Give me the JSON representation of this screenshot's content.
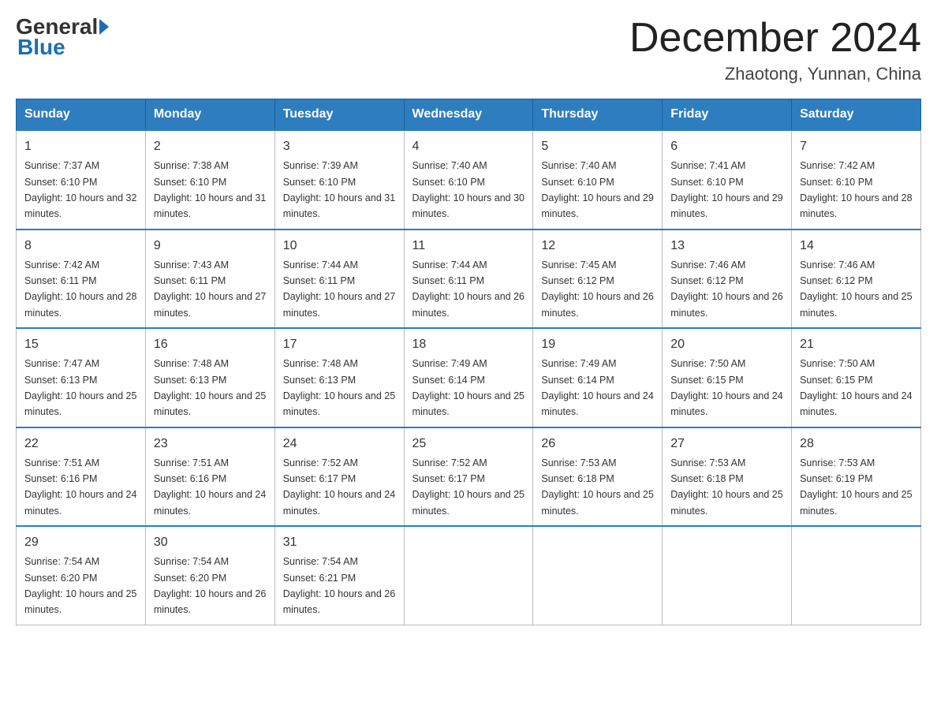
{
  "logo": {
    "general": "General",
    "blue": "Blue"
  },
  "header": {
    "month": "December 2024",
    "location": "Zhaotong, Yunnan, China"
  },
  "days_of_week": [
    "Sunday",
    "Monday",
    "Tuesday",
    "Wednesday",
    "Thursday",
    "Friday",
    "Saturday"
  ],
  "weeks": [
    [
      {
        "day": "1",
        "sunrise": "7:37 AM",
        "sunset": "6:10 PM",
        "daylight": "10 hours and 32 minutes."
      },
      {
        "day": "2",
        "sunrise": "7:38 AM",
        "sunset": "6:10 PM",
        "daylight": "10 hours and 31 minutes."
      },
      {
        "day": "3",
        "sunrise": "7:39 AM",
        "sunset": "6:10 PM",
        "daylight": "10 hours and 31 minutes."
      },
      {
        "day": "4",
        "sunrise": "7:40 AM",
        "sunset": "6:10 PM",
        "daylight": "10 hours and 30 minutes."
      },
      {
        "day": "5",
        "sunrise": "7:40 AM",
        "sunset": "6:10 PM",
        "daylight": "10 hours and 29 minutes."
      },
      {
        "day": "6",
        "sunrise": "7:41 AM",
        "sunset": "6:10 PM",
        "daylight": "10 hours and 29 minutes."
      },
      {
        "day": "7",
        "sunrise": "7:42 AM",
        "sunset": "6:10 PM",
        "daylight": "10 hours and 28 minutes."
      }
    ],
    [
      {
        "day": "8",
        "sunrise": "7:42 AM",
        "sunset": "6:11 PM",
        "daylight": "10 hours and 28 minutes."
      },
      {
        "day": "9",
        "sunrise": "7:43 AM",
        "sunset": "6:11 PM",
        "daylight": "10 hours and 27 minutes."
      },
      {
        "day": "10",
        "sunrise": "7:44 AM",
        "sunset": "6:11 PM",
        "daylight": "10 hours and 27 minutes."
      },
      {
        "day": "11",
        "sunrise": "7:44 AM",
        "sunset": "6:11 PM",
        "daylight": "10 hours and 26 minutes."
      },
      {
        "day": "12",
        "sunrise": "7:45 AM",
        "sunset": "6:12 PM",
        "daylight": "10 hours and 26 minutes."
      },
      {
        "day": "13",
        "sunrise": "7:46 AM",
        "sunset": "6:12 PM",
        "daylight": "10 hours and 26 minutes."
      },
      {
        "day": "14",
        "sunrise": "7:46 AM",
        "sunset": "6:12 PM",
        "daylight": "10 hours and 25 minutes."
      }
    ],
    [
      {
        "day": "15",
        "sunrise": "7:47 AM",
        "sunset": "6:13 PM",
        "daylight": "10 hours and 25 minutes."
      },
      {
        "day": "16",
        "sunrise": "7:48 AM",
        "sunset": "6:13 PM",
        "daylight": "10 hours and 25 minutes."
      },
      {
        "day": "17",
        "sunrise": "7:48 AM",
        "sunset": "6:13 PM",
        "daylight": "10 hours and 25 minutes."
      },
      {
        "day": "18",
        "sunrise": "7:49 AM",
        "sunset": "6:14 PM",
        "daylight": "10 hours and 25 minutes."
      },
      {
        "day": "19",
        "sunrise": "7:49 AM",
        "sunset": "6:14 PM",
        "daylight": "10 hours and 24 minutes."
      },
      {
        "day": "20",
        "sunrise": "7:50 AM",
        "sunset": "6:15 PM",
        "daylight": "10 hours and 24 minutes."
      },
      {
        "day": "21",
        "sunrise": "7:50 AM",
        "sunset": "6:15 PM",
        "daylight": "10 hours and 24 minutes."
      }
    ],
    [
      {
        "day": "22",
        "sunrise": "7:51 AM",
        "sunset": "6:16 PM",
        "daylight": "10 hours and 24 minutes."
      },
      {
        "day": "23",
        "sunrise": "7:51 AM",
        "sunset": "6:16 PM",
        "daylight": "10 hours and 24 minutes."
      },
      {
        "day": "24",
        "sunrise": "7:52 AM",
        "sunset": "6:17 PM",
        "daylight": "10 hours and 24 minutes."
      },
      {
        "day": "25",
        "sunrise": "7:52 AM",
        "sunset": "6:17 PM",
        "daylight": "10 hours and 25 minutes."
      },
      {
        "day": "26",
        "sunrise": "7:53 AM",
        "sunset": "6:18 PM",
        "daylight": "10 hours and 25 minutes."
      },
      {
        "day": "27",
        "sunrise": "7:53 AM",
        "sunset": "6:18 PM",
        "daylight": "10 hours and 25 minutes."
      },
      {
        "day": "28",
        "sunrise": "7:53 AM",
        "sunset": "6:19 PM",
        "daylight": "10 hours and 25 minutes."
      }
    ],
    [
      {
        "day": "29",
        "sunrise": "7:54 AM",
        "sunset": "6:20 PM",
        "daylight": "10 hours and 25 minutes."
      },
      {
        "day": "30",
        "sunrise": "7:54 AM",
        "sunset": "6:20 PM",
        "daylight": "10 hours and 26 minutes."
      },
      {
        "day": "31",
        "sunrise": "7:54 AM",
        "sunset": "6:21 PM",
        "daylight": "10 hours and 26 minutes."
      },
      null,
      null,
      null,
      null
    ]
  ],
  "labels": {
    "sunrise": "Sunrise: ",
    "sunset": "Sunset: ",
    "daylight": "Daylight: "
  }
}
